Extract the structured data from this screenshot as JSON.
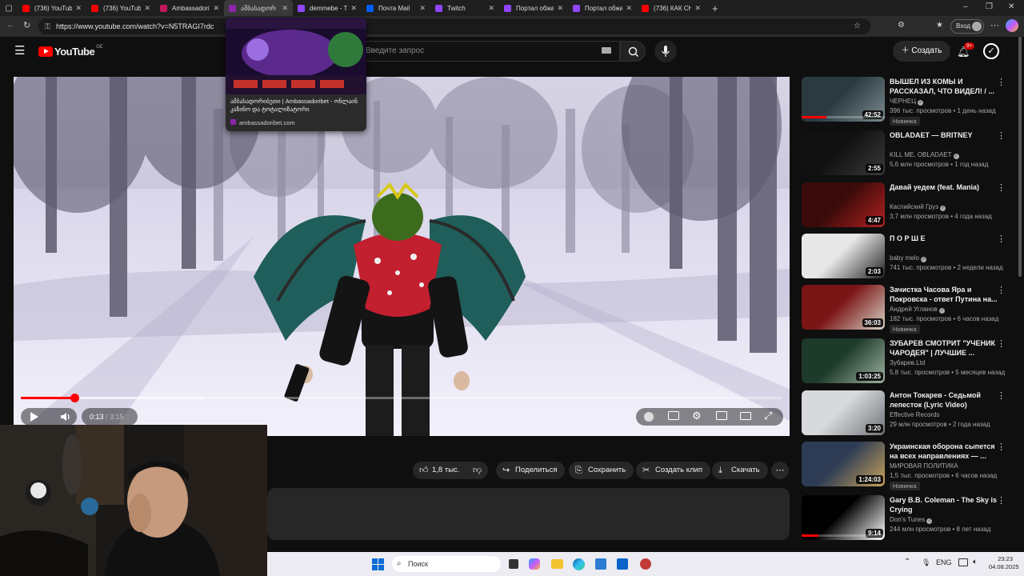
{
  "browser": {
    "tabs": [
      {
        "title": "(736) YouTube",
        "color": "#ff0000",
        "active": false
      },
      {
        "title": "(736) YouTube",
        "color": "#ff0000",
        "active": false
      },
      {
        "title": "Ambassadori",
        "color": "#c2185b",
        "active": false
      },
      {
        "title": "ამბასადორ",
        "color": "#8e24aa",
        "active": true
      },
      {
        "title": "demmebe - T",
        "color": "#9146ff",
        "active": false
      },
      {
        "title": "Почта Mail",
        "color": "#005ff9",
        "active": false
      },
      {
        "title": "Twitch",
        "color": "#9146ff",
        "active": false
      },
      {
        "title": "Портал обжа",
        "color": "#9146ff",
        "active": false
      },
      {
        "title": "Портал обжа",
        "color": "#9146ff",
        "active": false
      },
      {
        "title": "(736) КАК СН",
        "color": "#ff0000",
        "active": false
      }
    ],
    "new_tab": "+",
    "url": "https://www.youtube.com/watch?v=N5TRAGI7rdc",
    "profile_label": "Вход",
    "win_min": "–",
    "win_max": "❐",
    "win_close": "✕"
  },
  "tab_popup": {
    "title": "ამბასადორიბეთი | Ambassadoribet - ონლაინ კაზინო და ტოტალიზატორი",
    "domain": "ambassadoribet.com"
  },
  "youtube": {
    "logo_text": "YouTube",
    "region": "GE",
    "search_placeholder": "Введите запрос",
    "create_label": "Создать",
    "notif_count": "9+"
  },
  "player": {
    "progress": 0.07,
    "buffered": 0.24,
    "time_current": "0:13",
    "time_duration": "3:15"
  },
  "actions": {
    "likes": "1,8 тыс.",
    "share": "Поделиться",
    "save": "Сохранить",
    "clip": "Создать клип",
    "download": "Скачать"
  },
  "recommendations": [
    {
      "title": "ВЫШЕЛ ИЗ КОМЫ И РАССКАЗАЛ, ЧТО ВИДЕЛ! / ...",
      "channel": "ЧЕРНЕЦ",
      "verified": true,
      "meta": "396 тыс. просмотров • 1 день назад",
      "badge": "Новинка",
      "duration": "42:52",
      "watched": 0.3,
      "thumb": [
        "#2b3a40",
        "#7a8b8f"
      ]
    },
    {
      "title": "OBLADAET — BRITNEY",
      "channel": "KILL ME, OBLADAET",
      "verified": true,
      "meta": "5,6 млн просмотров • 1 год назад",
      "badge": "",
      "duration": "2:55",
      "watched": 0,
      "thumb": [
        "#111111",
        "#3a3a3a"
      ]
    },
    {
      "title": "Давай уедем (feat. Mania)",
      "channel": "Каспийский Груз",
      "verified": true,
      "meta": "3,7 млн просмотров • 4 года назад",
      "badge": "",
      "duration": "4:47",
      "watched": 0,
      "thumb": [
        "#3a0a0a",
        "#b32222"
      ]
    },
    {
      "title": "П О Р Ш Е",
      "channel": "baby melo",
      "verified": true,
      "meta": "741 тыс. просмотров • 2 недели назад",
      "badge": "",
      "duration": "2:03",
      "watched": 0,
      "thumb": [
        "#e8e8e8",
        "#222222"
      ]
    },
    {
      "title": "Зачистка Часова Яра и Покровска - ответ Путина на...",
      "channel": "Андрей Угланов",
      "verified": true,
      "meta": "182 тыс. просмотров • 6 часов назад",
      "badge": "Новинка",
      "duration": "36:03",
      "watched": 0,
      "thumb": [
        "#7a1515",
        "#d9d4c8"
      ]
    },
    {
      "title": "ЗУБАРЕВ СМОТРИТ \"УЧЕНИК ЧАРОДЕЯ\" | ЛУЧШИЕ ...",
      "channel": "Зубарев.Ltd",
      "verified": false,
      "meta": "5,8 тыс. просмотров • 5 месяцев назад",
      "badge": "",
      "duration": "1:03:25",
      "watched": 0,
      "thumb": [
        "#1d3a2a",
        "#9fb3a0"
      ]
    },
    {
      "title": "Антон Токарев - Седьмой лепесток (Lyric Video)",
      "channel": "Effective Records",
      "verified": false,
      "meta": "29 млн просмотров • 2 года назад",
      "badge": "",
      "duration": "3:20",
      "watched": 0,
      "thumb": [
        "#d7d9dc",
        "#6e7377"
      ]
    },
    {
      "title": "Украинская оборона сыпется на всех направлениях — ...",
      "channel": "МИРОВАЯ ПОЛИТИКА",
      "verified": false,
      "meta": "1,5 тыс. просмотров • 6 часов назад",
      "badge": "Новинка",
      "duration": "1:24:03",
      "watched": 0,
      "thumb": [
        "#2d3b55",
        "#c9a55b"
      ]
    },
    {
      "title": "Gary B.B. Coleman - The Sky is Crying",
      "channel": "Don's Tunes",
      "verified": true,
      "meta": "244 млн просмотров • 8 лет назад",
      "badge": "",
      "duration": "9:14",
      "watched": 0.2,
      "thumb": [
        "#000000",
        "#ffffff"
      ]
    }
  ],
  "taskbar": {
    "search_label": "Поиск",
    "lang": "ENG",
    "time": "23:23",
    "date": "04.08.2025"
  }
}
